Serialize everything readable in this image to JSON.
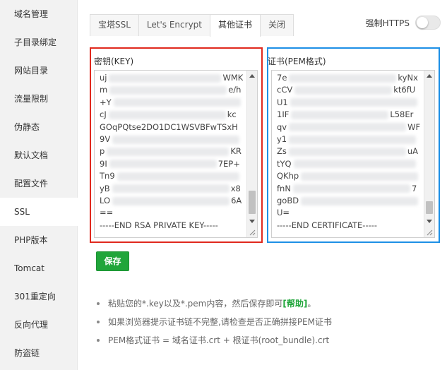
{
  "sidebar": {
    "items": [
      {
        "label": "域名管理"
      },
      {
        "label": "子目录绑定"
      },
      {
        "label": "网站目录"
      },
      {
        "label": "流量限制"
      },
      {
        "label": "伪静态"
      },
      {
        "label": "默认文档"
      },
      {
        "label": "配置文件"
      },
      {
        "label": "SSL"
      },
      {
        "label": "PHP版本"
      },
      {
        "label": "Tomcat"
      },
      {
        "label": "301重定向"
      },
      {
        "label": "反向代理"
      },
      {
        "label": "防盗链"
      }
    ],
    "active_index": 7
  },
  "tabs": [
    {
      "label": "宝塔SSL"
    },
    {
      "label": "Let's Encrypt"
    },
    {
      "label": "其他证书"
    },
    {
      "label": "关闭"
    }
  ],
  "active_tab": 2,
  "https": {
    "label": "强制HTTPS",
    "enabled": false
  },
  "key_panel": {
    "title": "密钥(KEY)",
    "lines": [
      "uj",
      "m",
      "+Y",
      "cJ",
      "GOqPQtse2DO1DC1WSVBFwTSxH",
      "9V",
      "p",
      "9I",
      "Tn9",
      "yB",
      "LO",
      "==",
      "-----END RSA PRIVATE KEY-----"
    ],
    "lines_tail": [
      "WMK",
      "e/h",
      "",
      "kc",
      "",
      "",
      "KR",
      "7EP+",
      "",
      "x8",
      "6A",
      "",
      ""
    ],
    "scroll_position": 0.78,
    "border_color": "#e0291e"
  },
  "cert_panel": {
    "title": "证书(PEM格式)",
    "lines": [
      "7e",
      "cCV",
      "U1",
      "1IF",
      "qv",
      "y1",
      "Zs",
      "tYQ",
      "QKhp",
      "fnN",
      "goBD",
      "U=",
      "-----END CERTIFICATE-----"
    ],
    "lines_tail": [
      "kyNx",
      "kt6fU",
      "",
      "L58Er",
      "WF",
      "",
      "uA",
      "",
      "",
      "7",
      "",
      "",
      ""
    ],
    "scroll_position": 0.92,
    "border_color": "#1e90e6"
  },
  "save_button": {
    "label": "保存",
    "color": "#20a53a"
  },
  "tips": [
    {
      "text": "粘贴您的*.key以及*.pem内容，然后保存即可",
      "link": "[帮助]",
      "suffix": "。"
    },
    {
      "text": "如果浏览器提示证书链不完整,请检查是否正确拼接PEM证书",
      "link": "",
      "suffix": ""
    },
    {
      "text": "PEM格式证书 = 域名证书.crt + 根证书(root_bundle).crt",
      "link": "",
      "suffix": ""
    }
  ]
}
